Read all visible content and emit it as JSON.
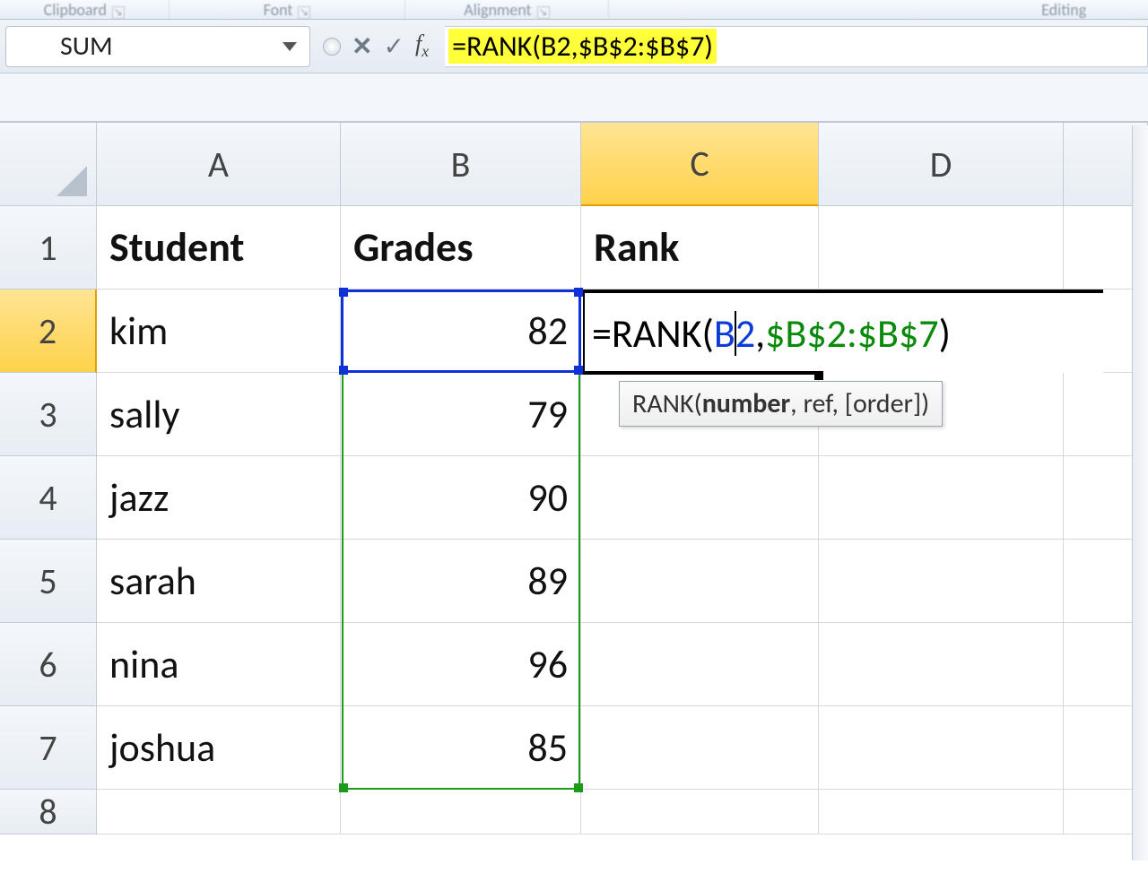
{
  "ribbon": {
    "groups": [
      "Clipboard",
      "Font",
      "Alignment",
      "",
      "Editing"
    ]
  },
  "namebox": {
    "value": "SUM"
  },
  "formula_bar": {
    "cancel": "✕",
    "enter": "✓",
    "fx": "fx",
    "formula": "=RANK(B2,$B$2:$B$7)"
  },
  "columns": [
    "A",
    "B",
    "C",
    "D"
  ],
  "row_numbers": [
    "1",
    "2",
    "3",
    "4",
    "5",
    "6",
    "7",
    "8"
  ],
  "headers": {
    "A": "Student",
    "B": "Grades",
    "C": "Rank"
  },
  "rows": [
    {
      "A": "kim",
      "B": "82"
    },
    {
      "A": "sally",
      "B": "79"
    },
    {
      "A": "jazz",
      "B": "90"
    },
    {
      "A": "sarah",
      "B": "89"
    },
    {
      "A": "nina",
      "B": "96"
    },
    {
      "A": "joshua",
      "B": "85"
    }
  ],
  "editing": {
    "prefix": "=RANK(",
    "arg1a": "B",
    "arg1b": "2",
    "comma": ",",
    "arg2": "$B$2:$B$7",
    "suffix": ")"
  },
  "tooltip": {
    "fn": "RANK(",
    "p1": "number",
    "rest": ", ref, [order])"
  },
  "chart_data": {
    "type": "table",
    "columns": [
      "Student",
      "Grades"
    ],
    "rows": [
      [
        "kim",
        82
      ],
      [
        "sally",
        79
      ],
      [
        "jazz",
        90
      ],
      [
        "sarah",
        89
      ],
      [
        "nina",
        96
      ],
      [
        "joshua",
        85
      ]
    ],
    "formula": "=RANK(B2,$B$2:$B$7)",
    "active_cell": "C2",
    "referenced_cell": "B2",
    "referenced_range": "$B$2:$B$7"
  }
}
